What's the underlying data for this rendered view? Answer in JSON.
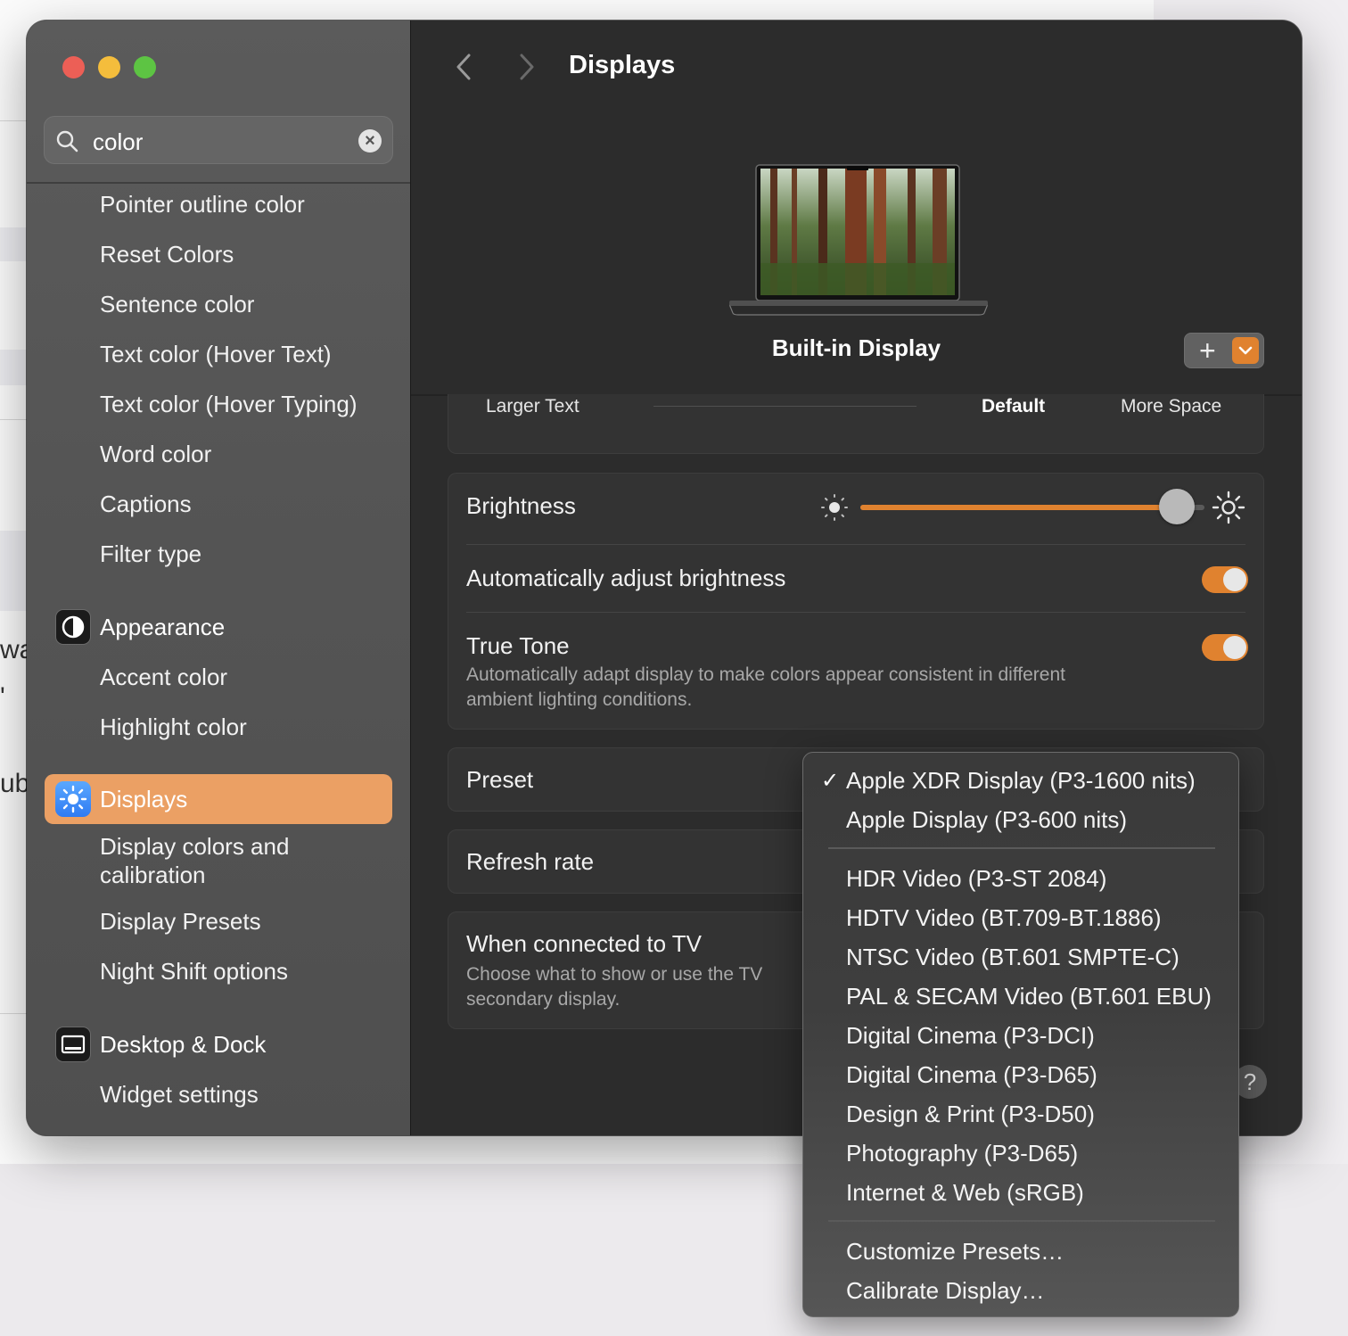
{
  "background": {
    "text_fragments": [
      "was",
      "'",
      "ub"
    ]
  },
  "window": {
    "title": "Displays"
  },
  "search": {
    "value": "color",
    "placeholder": "Search"
  },
  "sidebar": {
    "results_top": [
      "Pointer outline color",
      "Reset Colors",
      "Sentence color",
      "Text color (Hover Text)",
      "Text color (Hover Typing)",
      "Word color",
      "Captions",
      "Filter type"
    ],
    "appearance": {
      "label": "Appearance",
      "items": [
        "Accent color",
        "Highlight color"
      ]
    },
    "displays": {
      "label": "Displays",
      "items": [
        "Display colors and",
        "calibration",
        "Display Presets",
        "Night Shift options"
      ]
    },
    "desktop": {
      "label": "Desktop & Dock",
      "items": [
        "Widget settings"
      ]
    }
  },
  "display": {
    "name": "Built-in Display",
    "add_label": "+"
  },
  "resolution": {
    "larger": "Larger Text",
    "default": "Default",
    "more": "More Space"
  },
  "brightness": {
    "label": "Brightness",
    "value": 0.92
  },
  "auto_brightness": {
    "label": "Automatically adjust brightness",
    "on": true
  },
  "true_tone": {
    "label": "True Tone",
    "description_line1": "Automatically adapt display to make colors appear consistent in different",
    "description_line2": "ambient lighting conditions.",
    "on": true
  },
  "preset": {
    "label": "Preset"
  },
  "refresh": {
    "label": "Refresh rate"
  },
  "tv": {
    "label": "When connected to TV",
    "description_line1": "Choose what to show or use the TV",
    "description_line2": "secondary display."
  },
  "preset_menu": {
    "selected": "Apple XDR Display (P3-1600 nits)",
    "group1": [
      "Apple XDR Display (P3-1600 nits)",
      "Apple Display (P3-600 nits)"
    ],
    "group2": [
      "HDR Video (P3-ST 2084)",
      "HDTV Video (BT.709-BT.1886)",
      "NTSC Video (BT.601 SMPTE-C)",
      "PAL & SECAM Video (BT.601 EBU)",
      "Digital Cinema (P3-DCI)",
      "Digital Cinema (P3-D65)",
      "Design & Print (P3-D50)",
      "Photography (P3-D65)",
      "Internet & Web (sRGB)"
    ],
    "group3": [
      "Customize Presets…",
      "Calibrate Display…"
    ]
  },
  "help": {
    "label": "?"
  },
  "colors": {
    "accent": "#e0822f",
    "selection": "#eba064"
  }
}
